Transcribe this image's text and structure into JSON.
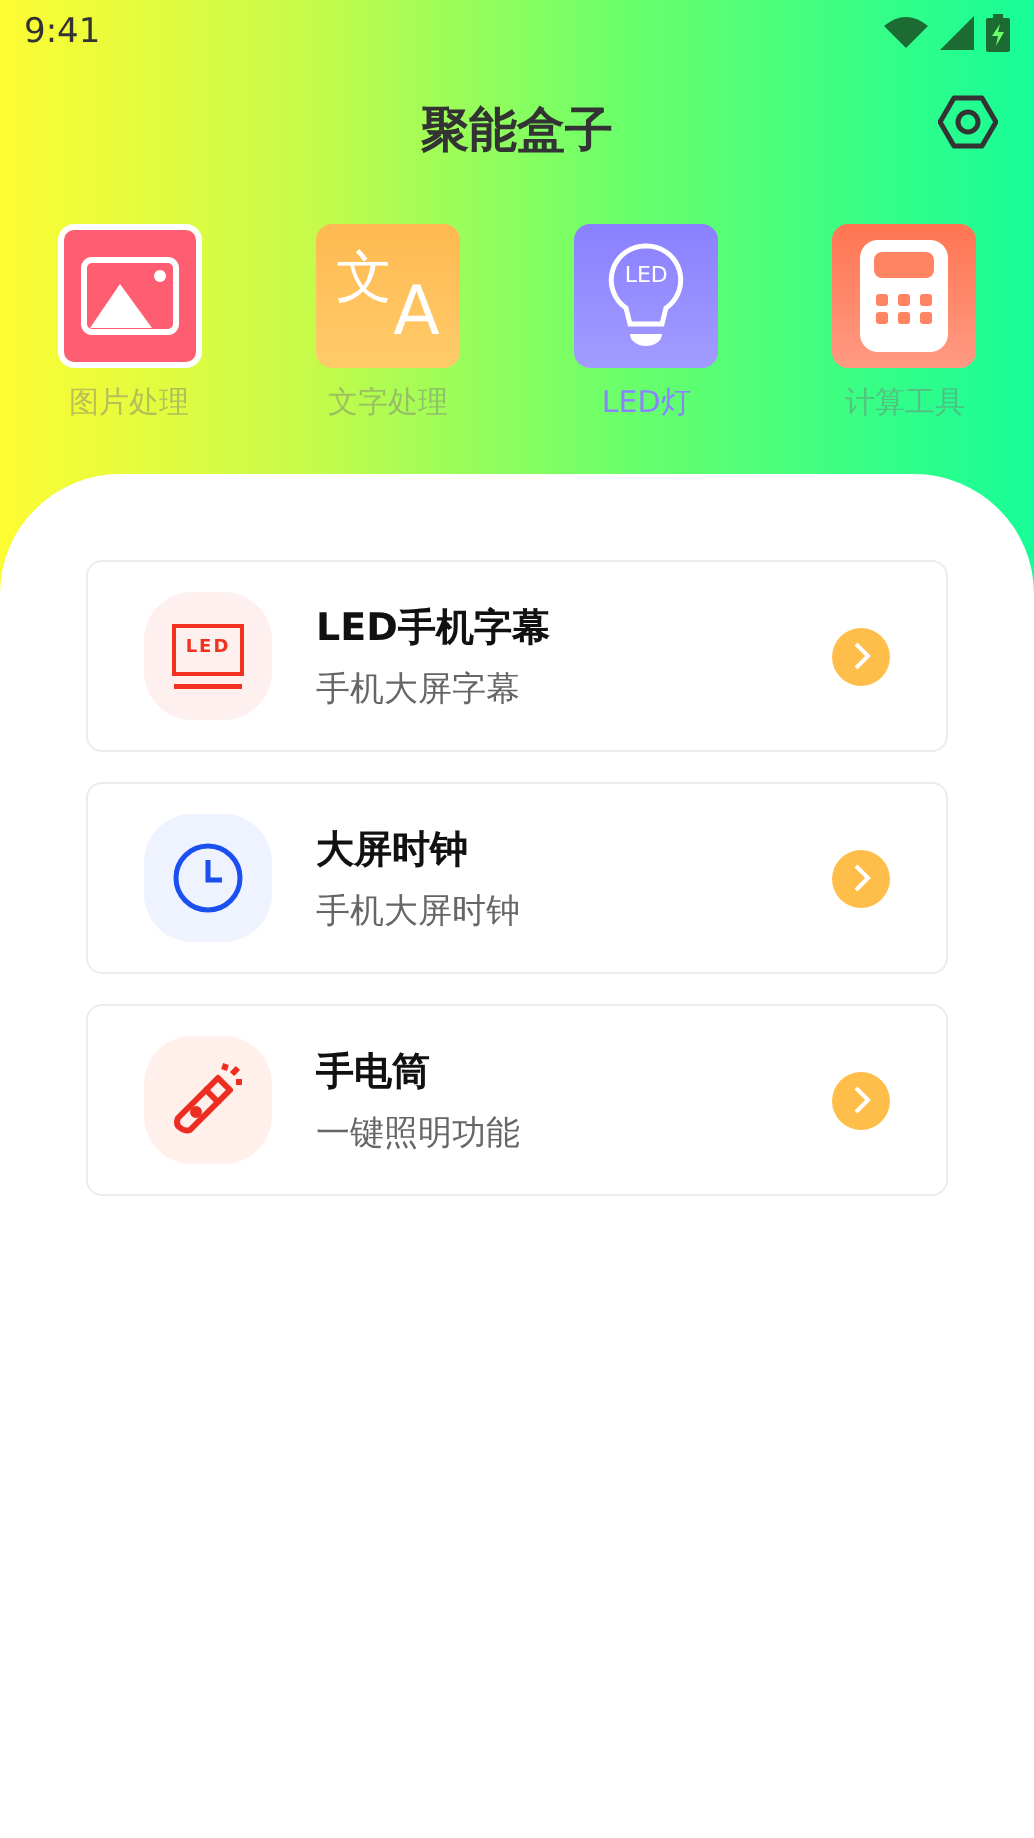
{
  "status_bar": {
    "time": "9:41"
  },
  "header": {
    "title": "聚能盒子"
  },
  "tools": [
    {
      "kind": "image",
      "label": "图片处理",
      "selected": false,
      "outlined": true
    },
    {
      "kind": "translate",
      "label": "文字处理",
      "selected": false,
      "outlined": false,
      "glyph_a": "文",
      "glyph_b": "A"
    },
    {
      "kind": "bulb",
      "label": "LED灯",
      "selected": true,
      "outlined": false,
      "glyph_a": "LED"
    },
    {
      "kind": "calculator",
      "label": "计算工具",
      "selected": false,
      "outlined": false
    }
  ],
  "features": [
    {
      "kind": "led",
      "title": "LED手机字幕",
      "subtitle": "手机大屏字幕",
      "glyph": "LED"
    },
    {
      "kind": "clock",
      "title": "大屏时钟",
      "subtitle": "手机大屏时钟"
    },
    {
      "kind": "flashlight",
      "title": "手电筒",
      "subtitle": "一键照明功能"
    }
  ]
}
